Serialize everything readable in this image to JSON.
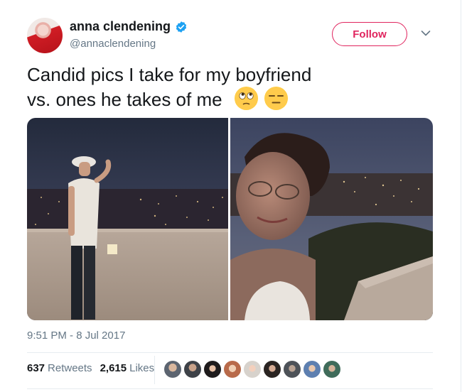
{
  "user": {
    "display_name": "anna clendening",
    "handle": "@annaclendening",
    "verified": true
  },
  "actions": {
    "follow_label": "Follow"
  },
  "tweet": {
    "line1": "Candid pics I take for my boyfriend",
    "line2": "vs. ones he takes of me",
    "emojis": [
      "face-with-rolling-eyes",
      "expressionless-face"
    ]
  },
  "media": [
    {
      "subject": "man-on-overlook-photo"
    },
    {
      "subject": "woman-selfie-photo"
    }
  ],
  "timestamp": "9:51 PM - 8 Jul 2017",
  "stats": {
    "retweets_count": "637",
    "retweets_label": "Retweets",
    "likes_count": "2,615",
    "likes_label": "Likes"
  },
  "likers_count": 9,
  "colors": {
    "accent": "#e0245e",
    "verified": "#1da1f2",
    "muted": "#657786",
    "text": "#14171a",
    "divider": "#e6ecf0"
  }
}
